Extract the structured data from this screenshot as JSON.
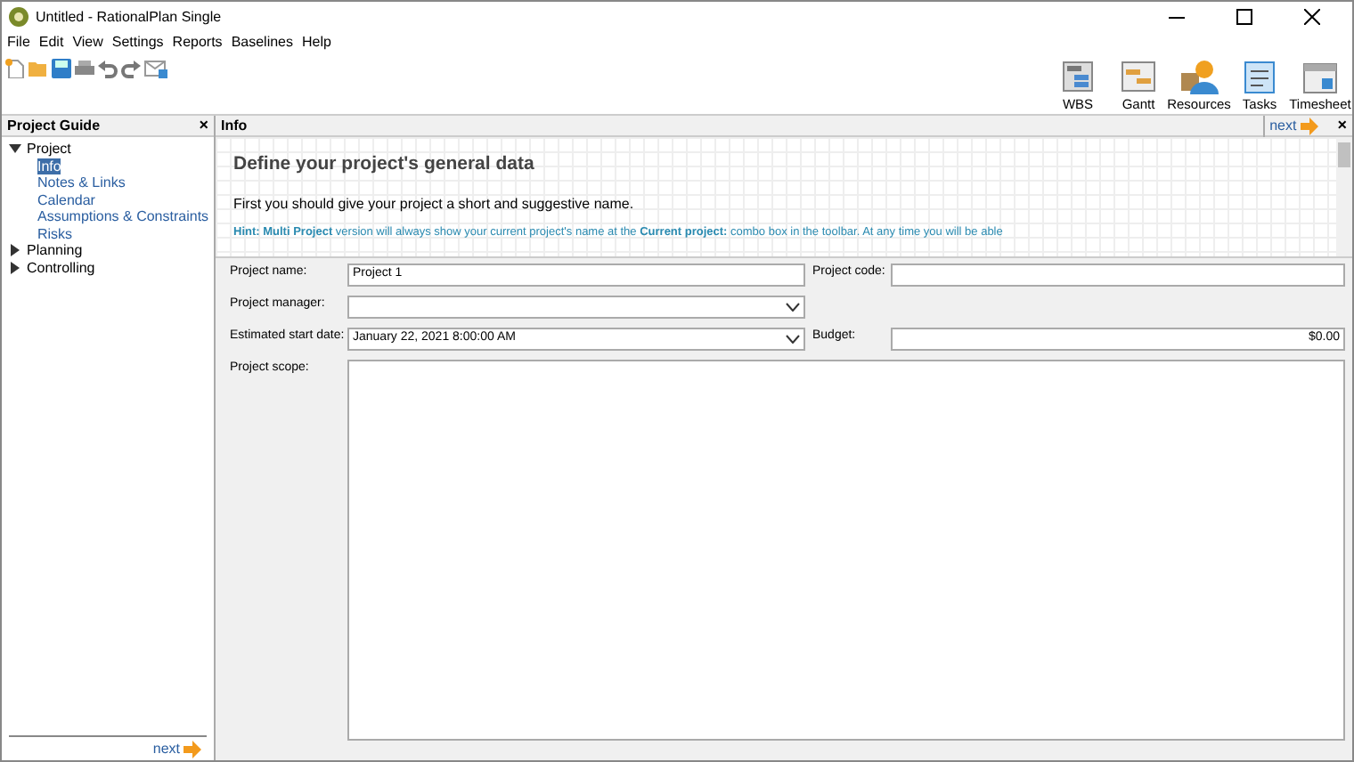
{
  "window": {
    "title": "Untitled - RationalPlan Single"
  },
  "menu": [
    "File",
    "Edit",
    "View",
    "Settings",
    "Reports",
    "Baselines",
    "Help"
  ],
  "views": [
    {
      "label": "WBS",
      "kind": "wbs"
    },
    {
      "label": "Gantt",
      "kind": "gantt"
    },
    {
      "label": "Resources",
      "kind": "resources"
    },
    {
      "label": "Tasks",
      "kind": "tasks"
    },
    {
      "label": "Timesheet",
      "kind": "timesheet"
    }
  ],
  "guide": {
    "title": "Project Guide",
    "close": "×",
    "next": "next",
    "tree": [
      {
        "label": "Project",
        "expanded": true,
        "children": [
          {
            "label": "Info",
            "selected": true
          },
          {
            "label": "Notes & Links",
            "selected": false
          },
          {
            "label": "Calendar",
            "selected": false
          },
          {
            "label": "Assumptions & Constraints",
            "selected": false
          },
          {
            "label": "Risks",
            "selected": false
          }
        ]
      },
      {
        "label": "Planning",
        "expanded": false
      },
      {
        "label": "Controlling",
        "expanded": false
      }
    ]
  },
  "info": {
    "title": "Info",
    "next": "next",
    "close": "×",
    "heading": "Define your project's general data",
    "text": "First you should give your project a short and suggestive name.",
    "hint": "**Hint: Multi Project** version will always show your current project's name at the **Current project:** combo box in the toolbar. At any time you will be able"
  },
  "form": {
    "project_name": {
      "label": "Project name:",
      "value": "Project 1"
    },
    "project_code": {
      "label": "Project code:"
    },
    "project_manager": {
      "label": "Project manager:"
    },
    "start_date": {
      "label": "Estimated start date:",
      "value": "January 22, 2021 8:00:00 AM"
    },
    "budget": {
      "label": "Budget:",
      "value": "$0.00"
    },
    "scope": {
      "label": "Project scope:"
    }
  }
}
